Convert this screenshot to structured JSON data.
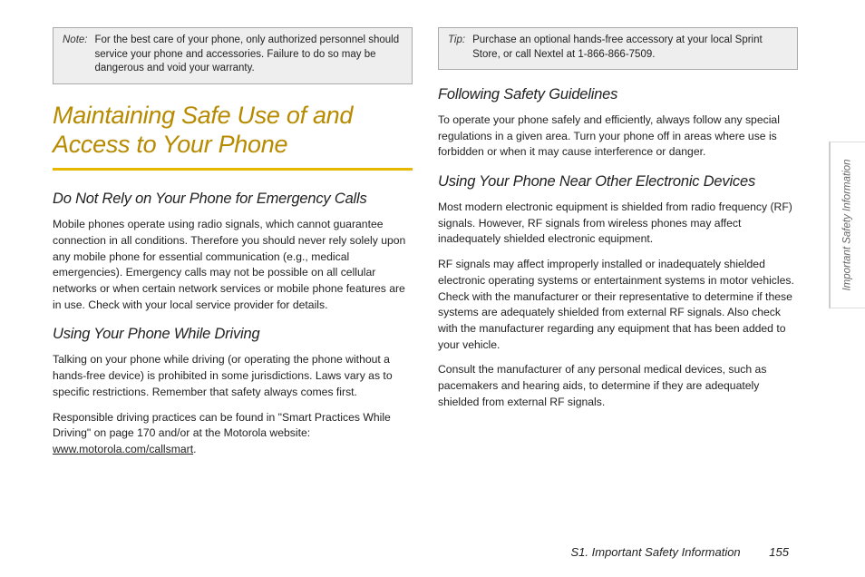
{
  "left": {
    "note": {
      "label": "Note:",
      "text": "For the best care of your phone, only authorized personnel should service your phone and accessories. Failure to do so may be dangerous and void your warranty."
    },
    "title": "Maintaining Safe Use of and Access to Your Phone",
    "h_emergency": "Do Not Rely on Your Phone for Emergency Calls",
    "p_emergency": "Mobile phones operate using radio signals, which cannot guarantee connection in all conditions. Therefore you should never rely solely upon any mobile phone for essential communication (e.g., medical emergencies). Emergency calls may not be possible on all cellular networks or when certain network services or mobile phone features are in use. Check with your local service provider for details.",
    "h_driving": "Using Your Phone While Driving",
    "p_driving1": "Talking on your phone while driving (or operating the phone without a hands-free device) is prohibited in some jurisdictions. Laws vary as to specific restrictions. Remember that safety always comes first.",
    "p_driving2a": "Responsible driving practices can be found in \"Smart Practices While Driving\" on page 170 and/or at the Motorola website: ",
    "p_driving2_link": "www.motorola.com/callsmart",
    "p_driving2b": "."
  },
  "right": {
    "tip": {
      "label": "Tip:",
      "text": "Purchase an optional hands-free accessory at your local Sprint Store, or call Nextel at 1-866-866-7509."
    },
    "h_follow": "Following Safety Guidelines",
    "p_follow": "To operate your phone safely and efficiently, always follow any special regulations in a given area. Turn your phone off in areas where use is forbidden or when it may cause interference or danger.",
    "h_elec": "Using Your Phone Near Other Electronic Devices",
    "p_elec1": "Most modern electronic equipment is shielded from radio frequency (RF) signals. However, RF signals from wireless phones may affect inadequately shielded electronic equipment.",
    "p_elec2": "RF signals may affect improperly installed or inadequately shielded electronic operating systems or entertainment systems in motor vehicles. Check with the manufacturer or their representative to determine if these systems are adequately shielded from external RF signals. Also check with the manufacturer regarding any equipment that has been added to your vehicle.",
    "p_elec3": "Consult the manufacturer of any personal medical devices, such as pacemakers and hearing aids, to determine if they are adequately shielded from external RF signals."
  },
  "footer": {
    "section": "S1. Important Safety Information",
    "page": "155"
  },
  "side_tab": "Important Safety Information"
}
